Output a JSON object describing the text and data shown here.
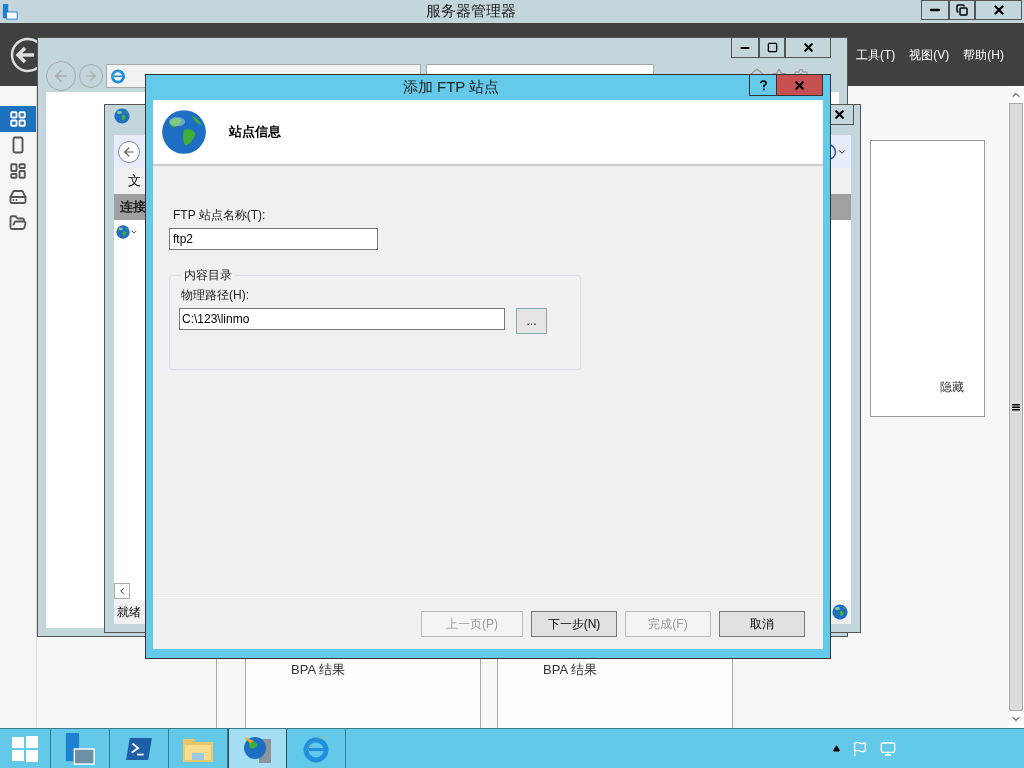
{
  "server_manager": {
    "title": "服务器管理器",
    "menu": [
      "工具(T)",
      "视图(V)",
      "帮助(H)"
    ],
    "nav_items": [
      {
        "kind": "dashboard",
        "selected": true
      },
      {
        "kind": "local",
        "selected": false
      },
      {
        "kind": "all",
        "selected": false
      },
      {
        "kind": "iis",
        "selected": false
      },
      {
        "kind": "files",
        "selected": false
      }
    ],
    "side_panel": {
      "link": "隐藏"
    },
    "tiles": [
      {
        "title": "BPA 结果"
      },
      {
        "title": "BPA 结果"
      }
    ]
  },
  "iis_manager": {
    "menu_fragment": "文",
    "connections_header": "连接",
    "status": "就绪"
  },
  "dialog": {
    "title": "添加 FTP 站点",
    "header": "站点信息",
    "site_name": {
      "label": "FTP 站点名称(T):",
      "value": "ftp2"
    },
    "content_directory": {
      "legend": "内容目录",
      "path_label": "物理路径(H):",
      "path_value": "C:\\123\\linmo",
      "browse": "..."
    },
    "buttons": [
      {
        "label": "上一页(P)",
        "disabled": true
      },
      {
        "label": "下一步(N)",
        "disabled": false
      },
      {
        "label": "完成(F)",
        "disabled": true
      },
      {
        "label": "取消",
        "disabled": false
      }
    ]
  },
  "taskbar": {
    "items": [
      {
        "kind": "start",
        "selected": false
      },
      {
        "kind": "server-manager",
        "selected": false
      },
      {
        "kind": "powershell",
        "selected": false
      },
      {
        "kind": "explorer",
        "selected": false
      },
      {
        "kind": "iis",
        "selected": true
      },
      {
        "kind": "ie",
        "selected": false
      }
    ]
  }
}
